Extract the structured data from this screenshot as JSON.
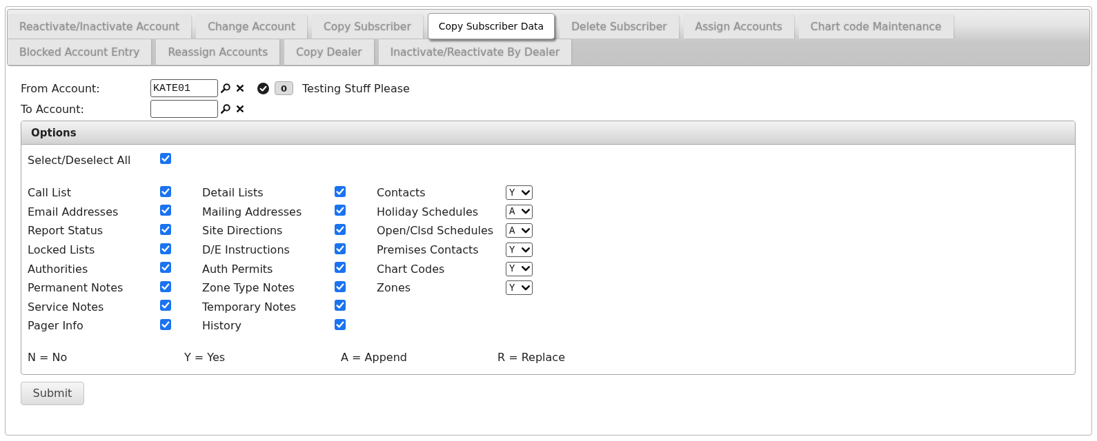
{
  "tab_rows": [
    {
      "tabs": [
        {
          "label": "Reactivate/Inactivate Account",
          "selected": false
        },
        {
          "label": "Change Account",
          "selected": false
        },
        {
          "label": "Copy Subscriber",
          "selected": false
        },
        {
          "label": "Copy Subscriber Data",
          "selected": true
        },
        {
          "label": "Delete Subscriber",
          "selected": false
        },
        {
          "label": "Assign Accounts",
          "selected": false
        },
        {
          "label": "Chart code Maintenance",
          "selected": false
        }
      ]
    },
    {
      "tabs": [
        {
          "label": "Blocked Account Entry",
          "selected": false
        },
        {
          "label": "Reassign Accounts",
          "selected": false
        },
        {
          "label": "Copy Dealer",
          "selected": false
        },
        {
          "label": "Inactivate/Reactivate By Dealer",
          "selected": false
        }
      ]
    }
  ],
  "account_fields": [
    {
      "label": "From Account:",
      "value": "KATE01",
      "badge": "0",
      "description": "Testing Stuff Please"
    },
    {
      "label": "To Account:"
    }
  ],
  "options": {
    "title": "Options",
    "select_all": {
      "label": "Select/Deselect All",
      "checked": true
    },
    "columns": [
      {
        "kind": "checkbox",
        "items": [
          {
            "label": "Call List",
            "checked": true
          },
          {
            "label": "Email Addresses",
            "checked": true
          },
          {
            "label": "Report Status",
            "checked": true
          },
          {
            "label": "Locked Lists",
            "checked": true
          },
          {
            "label": "Authorities",
            "checked": true
          },
          {
            "label": "Permanent Notes",
            "checked": true
          },
          {
            "label": "Service Notes",
            "checked": true
          },
          {
            "label": "Pager Info",
            "checked": true
          }
        ]
      },
      {
        "kind": "checkbox",
        "items": [
          {
            "label": "Detail Lists",
            "checked": true
          },
          {
            "label": "Mailing Addresses",
            "checked": true
          },
          {
            "label": "Site Directions",
            "checked": true
          },
          {
            "label": "D/E Instructions",
            "checked": true
          },
          {
            "label": "Auth Permits",
            "checked": true
          },
          {
            "label": "Zone Type Notes",
            "checked": true
          },
          {
            "label": "Temporary Notes",
            "checked": true
          },
          {
            "label": "History",
            "checked": true
          }
        ]
      },
      {
        "kind": "dropdown",
        "items": [
          {
            "label": "Contacts",
            "value": "Y"
          },
          {
            "label": "Holiday Schedules",
            "value": "A"
          },
          {
            "label": "Open/Clsd Schedules",
            "value": "A"
          },
          {
            "label": "Premises Contacts",
            "value": "Y"
          },
          {
            "label": "Chart Codes",
            "value": "Y"
          },
          {
            "label": "Zones",
            "value": "Y"
          }
        ]
      }
    ],
    "legend": [
      "N = No",
      "Y = Yes",
      "A = Append",
      "R = Replace"
    ]
  },
  "buttons": [
    "Submit"
  ]
}
